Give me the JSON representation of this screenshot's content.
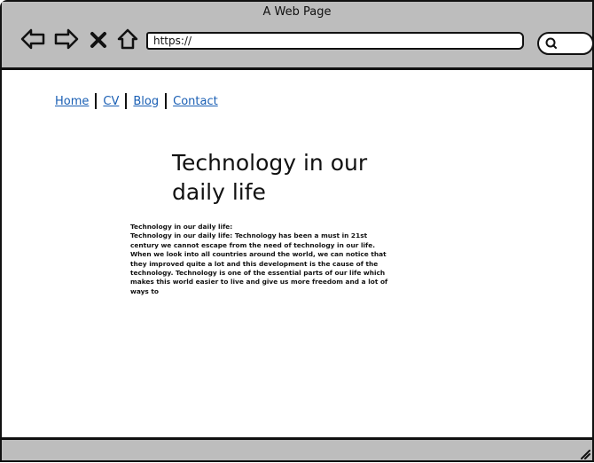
{
  "window": {
    "title": "A Web Page"
  },
  "toolbar": {
    "back_icon": "back-arrow-icon",
    "forward_icon": "forward-arrow-icon",
    "stop_icon": "close-icon",
    "home_icon": "home-icon"
  },
  "address_bar": {
    "value": "https://"
  },
  "search": {
    "icon": "search-icon"
  },
  "nav": {
    "links": [
      {
        "label": "Home"
      },
      {
        "label": "CV"
      },
      {
        "label": "Blog"
      },
      {
        "label": "Contact"
      }
    ]
  },
  "article": {
    "heading": "Technology in our daily life",
    "subheading": "Technology in our daily life:",
    "body": "Technology in our daily life: Technology has been a must in 21st century we cannot escape from the need of technology in our life. When we look into all countries around the world, we can notice that they improved quite a lot and this development is the cause of the technology. Technology is one of the essential parts of our life which makes this world easier to live and give us more freedom and a lot of ways to"
  },
  "colors": {
    "chrome": "#bdbdbd",
    "link": "#1a5fb4",
    "outline": "#111111"
  }
}
